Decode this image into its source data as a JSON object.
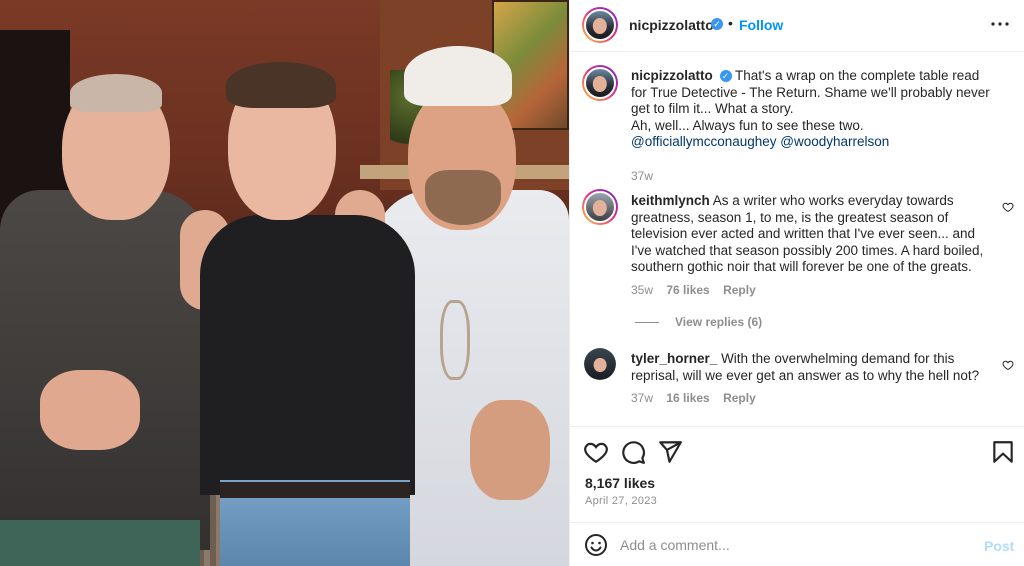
{
  "post": {
    "username": "nicpizzolatto",
    "follow_label": "Follow",
    "separator": "•",
    "more_label": "•••"
  },
  "caption": {
    "username": "nicpizzolatto",
    "text_line1": "That's a wrap on the complete table read for True Detective - The Return. Shame we'll probably never get to film it... What a story.",
    "text_line2": "Ah, well... Always fun to see these two.",
    "mention1": "@officiallymcconaughey",
    "mention2": "@woodyharrelson",
    "time": "37w"
  },
  "comments": [
    {
      "username": "keithmlynch",
      "text": "As a writer who works everyday towards greatness, season 1, to me, is the greatest season of television ever acted and written that I've ever seen... and I've watched that season possibly 200 times. A hard boiled, southern gothic noir that will forever be one of the greats.",
      "time": "35w",
      "likes": "76 likes",
      "reply": "Reply",
      "view_replies": "View replies (6)"
    },
    {
      "username": "tyler_horner_",
      "text": "With the overwhelming demand for this reprisal, will we ever get an answer as to why the hell not?",
      "time": "37w",
      "likes": "16 likes",
      "reply": "Reply"
    }
  ],
  "stats": {
    "likes": "8,167 likes",
    "date": "April 27, 2023"
  },
  "composer": {
    "placeholder": "Add a comment...",
    "post_label": "Post"
  },
  "icons": {
    "like": "heart-icon",
    "comment": "comment-icon",
    "share": "send-icon",
    "save": "bookmark-icon",
    "emoji": "emoji-icon",
    "verified": "verified-badge-icon"
  },
  "colors": {
    "link": "#0095f6",
    "mention": "#00376b",
    "muted": "#8e8e8e",
    "post_disabled": "#b3dbff"
  }
}
